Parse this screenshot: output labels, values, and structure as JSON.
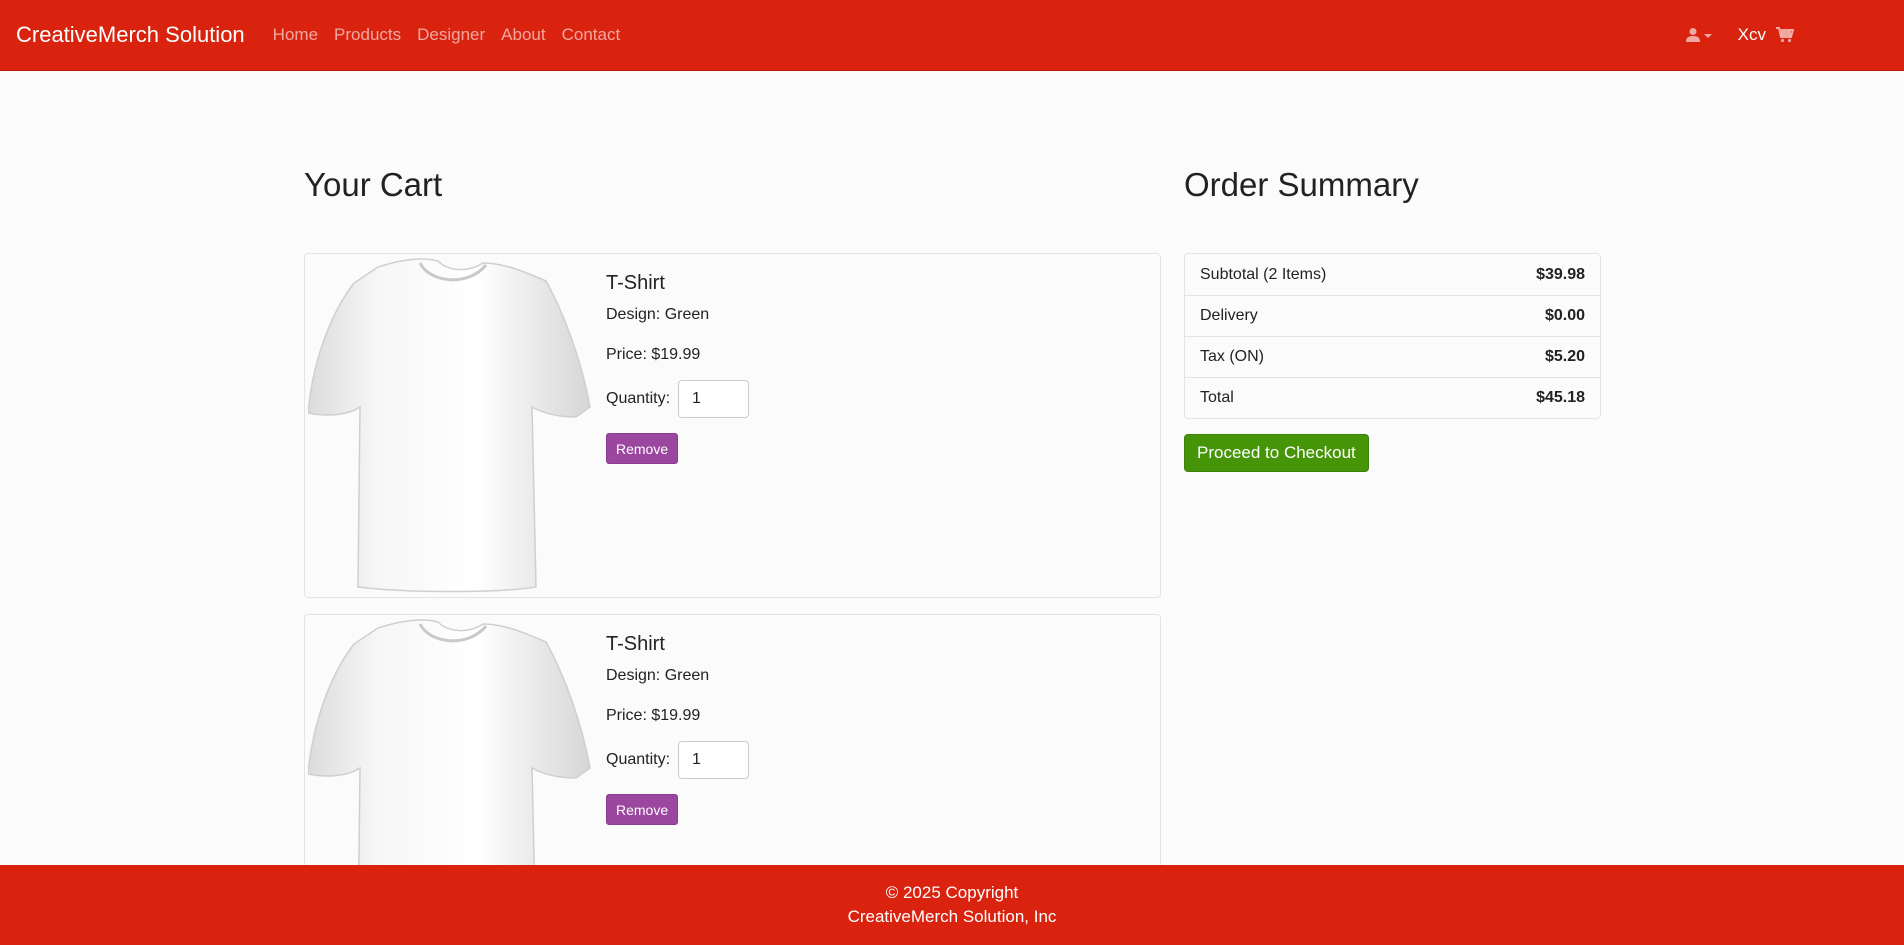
{
  "navbar": {
    "brand": "CreativeMerch Solution",
    "links": [
      "Home",
      "Products",
      "Designer",
      "About",
      "Contact"
    ],
    "user_icon": "user-icon",
    "user_name": "Xcv",
    "cart_icon": "shopping-cart-icon"
  },
  "cart": {
    "heading": "Your Cart",
    "items": [
      {
        "title": "T-Shirt",
        "design": "Design: Green",
        "price": "Price: $19.99",
        "quantity_label": "Quantity:",
        "quantity": "1",
        "remove_label": "Remove"
      },
      {
        "title": "T-Shirt",
        "design": "Design: Green",
        "price": "Price: $19.99",
        "quantity_label": "Quantity:",
        "quantity": "1",
        "remove_label": "Remove"
      }
    ]
  },
  "summary": {
    "heading": "Order Summary",
    "rows": [
      {
        "label": "Subtotal (2 Items)",
        "value": "$39.98"
      },
      {
        "label": "Delivery",
        "value": "$0.00"
      },
      {
        "label": "Tax (ON)",
        "value": "$5.20"
      },
      {
        "label": "Total",
        "value": "$45.18"
      }
    ],
    "checkout_label": "Proceed to Checkout"
  },
  "footer": {
    "copyright": "© 2025 Copyright",
    "company": "CreativeMerch Solution, Inc"
  },
  "colors": {
    "brand_red": "#d9230f",
    "remove_purple": "#9b479f",
    "checkout_green": "#469408"
  }
}
